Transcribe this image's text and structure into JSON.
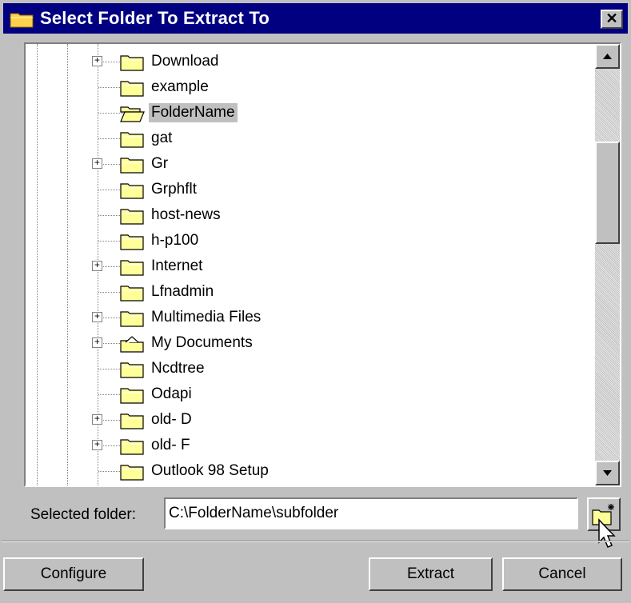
{
  "window": {
    "title": "Select Folder To Extract To",
    "close_glyph": "✕"
  },
  "tree": {
    "items": [
      {
        "label": "Download",
        "expandable": true,
        "icon": "folder-icon"
      },
      {
        "label": "example",
        "expandable": false,
        "icon": "folder-icon"
      },
      {
        "label": "FolderName",
        "expandable": false,
        "icon": "open-folder-icon",
        "selected": true
      },
      {
        "label": "gat",
        "expandable": false,
        "icon": "folder-icon"
      },
      {
        "label": "Gr",
        "expandable": true,
        "icon": "folder-icon"
      },
      {
        "label": "Grphflt",
        "expandable": false,
        "icon": "folder-icon"
      },
      {
        "label": "host-news",
        "expandable": false,
        "icon": "folder-icon"
      },
      {
        "label": "h-p100",
        "expandable": false,
        "icon": "folder-icon"
      },
      {
        "label": "Internet",
        "expandable": true,
        "icon": "folder-icon"
      },
      {
        "label": "Lfnadmin",
        "expandable": false,
        "icon": "folder-icon"
      },
      {
        "label": "Multimedia Files",
        "expandable": true,
        "icon": "folder-icon"
      },
      {
        "label": "My Documents",
        "expandable": true,
        "icon": "my-documents-folder-icon"
      },
      {
        "label": "Ncdtree",
        "expandable": false,
        "icon": "folder-icon"
      },
      {
        "label": "Odapi",
        "expandable": false,
        "icon": "folder-icon"
      },
      {
        "label": "old- D",
        "expandable": true,
        "icon": "folder-icon"
      },
      {
        "label": "old- F",
        "expandable": true,
        "icon": "folder-icon"
      },
      {
        "label": "Outlook 98 Setup",
        "expandable": false,
        "icon": "folder-icon"
      }
    ],
    "expand_glyph": "+"
  },
  "selected_folder": {
    "label": "Selected folder:",
    "value": "C:\\FolderName\\subfolder"
  },
  "buttons": {
    "configure": "Configure",
    "extract": "Extract",
    "cancel": "Cancel"
  },
  "colors": {
    "titlebar": "#000080",
    "face": "#c0c0c0",
    "folder_yellow": "#ffff99"
  }
}
